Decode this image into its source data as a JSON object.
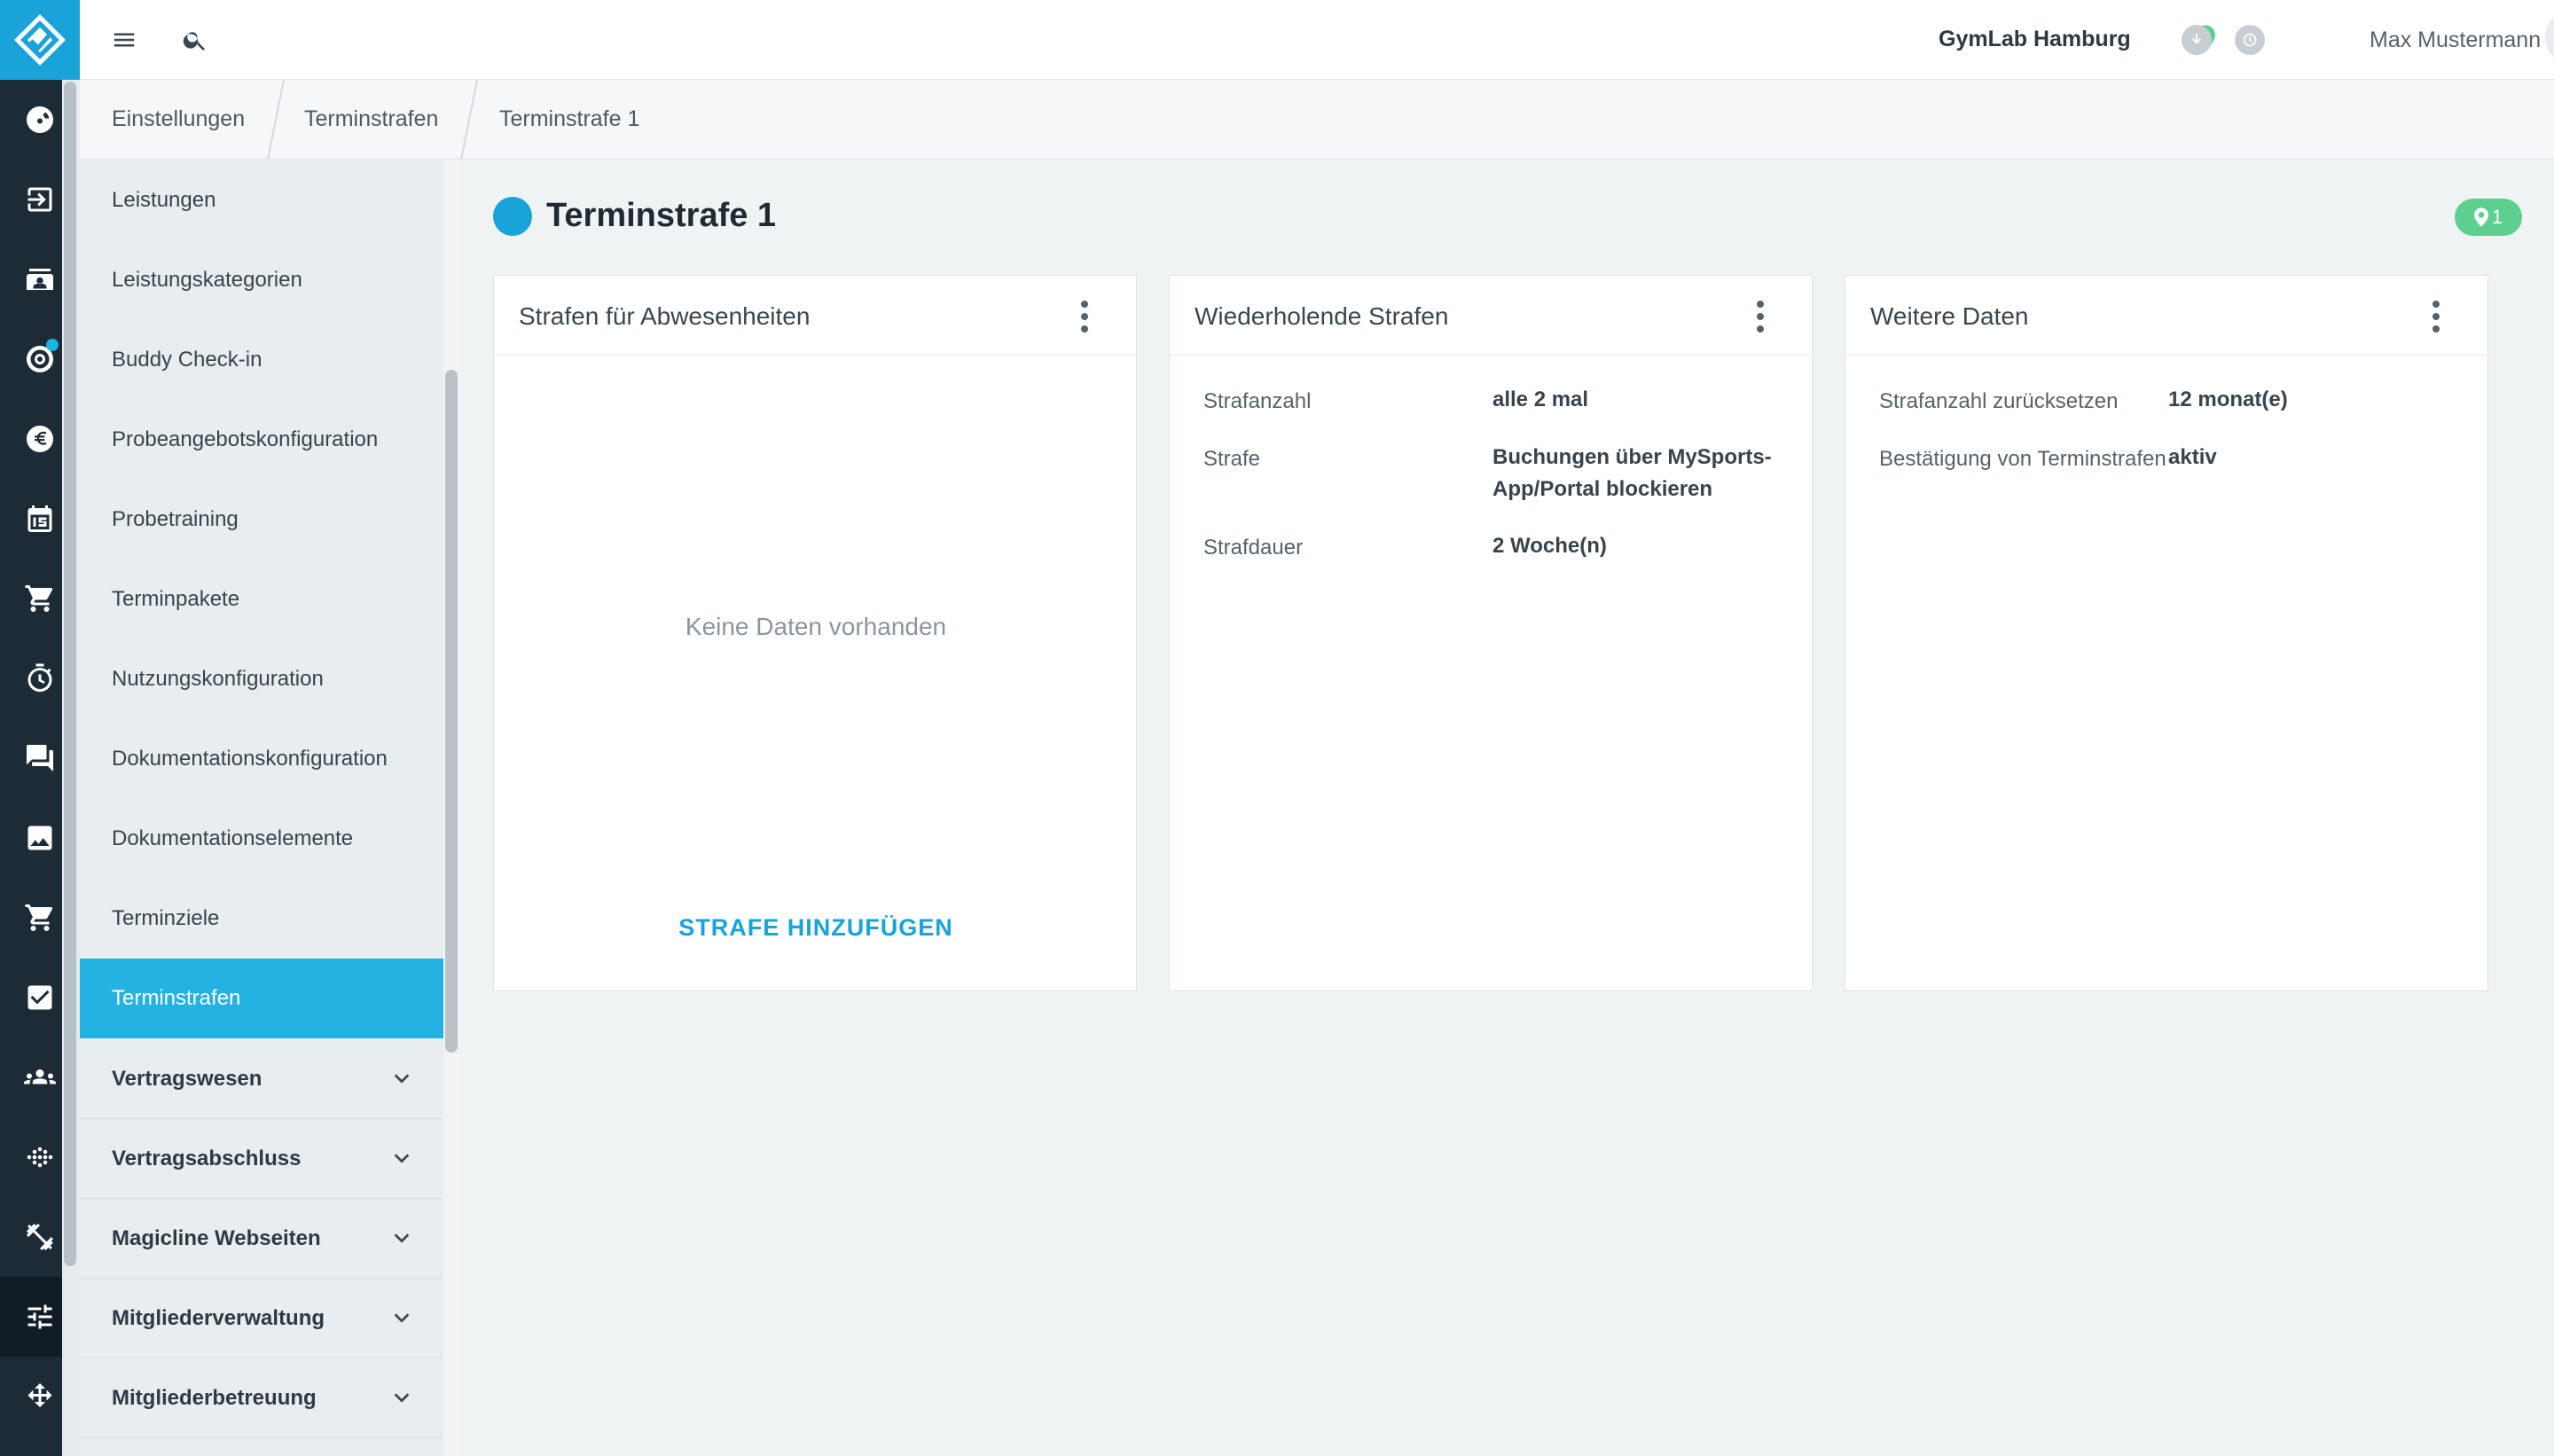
{
  "topbar": {
    "studio": "GymLab Hamburg",
    "user_name": "Max Mustermann"
  },
  "breadcrumb": [
    "Einstellungen",
    "Terminstrafen",
    "Terminstrafe 1"
  ],
  "sidebar": {
    "items": [
      {
        "label": "Leistungen"
      },
      {
        "label": "Leistungskategorien"
      },
      {
        "label": "Buddy Check-in"
      },
      {
        "label": "Probeangebotskonfiguration"
      },
      {
        "label": "Probetraining"
      },
      {
        "label": "Terminpakete"
      },
      {
        "label": "Nutzungskonfiguration"
      },
      {
        "label": "Dokumentationskonfiguration"
      },
      {
        "label": "Dokumentationselemente"
      },
      {
        "label": "Terminziele"
      },
      {
        "label": "Terminstrafen",
        "active": true
      }
    ],
    "sections": [
      {
        "label": "Vertragswesen"
      },
      {
        "label": "Vertragsabschluss"
      },
      {
        "label": "Magicline Webseiten"
      },
      {
        "label": "Mitgliederverwaltung"
      },
      {
        "label": "Mitgliederbetreuung"
      }
    ]
  },
  "page": {
    "title": "Terminstrafe 1",
    "location_count": "1"
  },
  "cards": {
    "absences": {
      "title": "Strafen für Abwesenheiten",
      "empty_text": "Keine Daten vorhanden",
      "add_label": "STRAFE HINZUFÜGEN"
    },
    "recurring": {
      "title": "Wiederholende Strafen",
      "rows": [
        {
          "label": "Strafanzahl",
          "value": "alle 2 mal"
        },
        {
          "label": "Strafe",
          "value_line1": "Buchungen über MySports-",
          "value_line2": "App/Portal blockieren"
        },
        {
          "label": "Strafdauer",
          "value": "2 Woche(n)"
        }
      ]
    },
    "more": {
      "title": "Weitere Daten",
      "rows": [
        {
          "label": "Strafanzahl zurücksetzen",
          "value": "12 monat(e)"
        },
        {
          "label": "Bestätigung von Terminstrafen",
          "value": "aktiv"
        }
      ]
    }
  },
  "colors": {
    "accent": "#1aa3d8",
    "rail": "#1d2b36",
    "active_item": "#24b2e3",
    "badge": "#5ccf91"
  },
  "rail_icons": [
    "dashboard-icon",
    "check-in-icon",
    "contacts-icon",
    "leads-icon",
    "finance-icon",
    "calendar-icon",
    "shop-icon",
    "timer-icon",
    "chat-icon",
    "image-icon",
    "cart-icon",
    "tasks-icon",
    "members-icon",
    "analytics-icon",
    "equipment-icon",
    "settings-icon",
    "integrations-icon"
  ]
}
